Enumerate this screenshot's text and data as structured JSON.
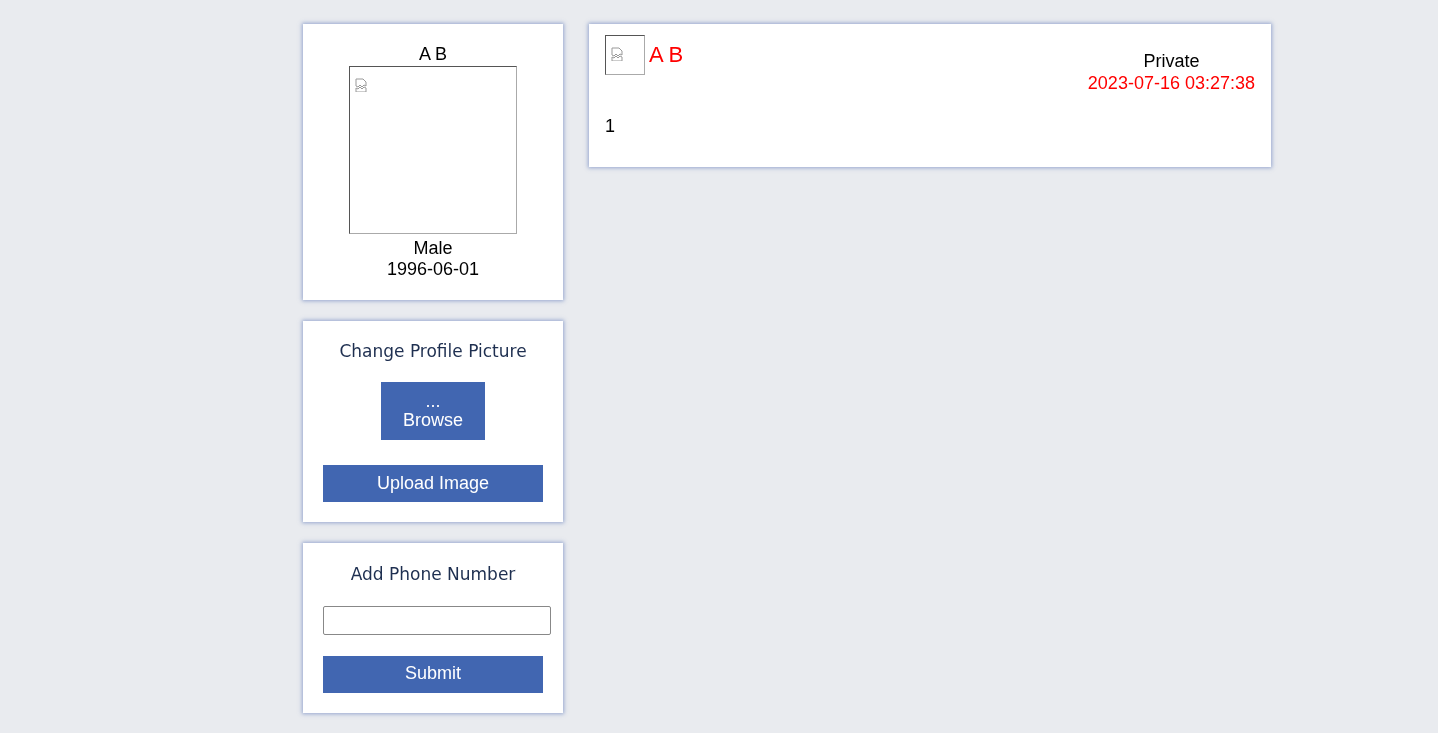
{
  "profile": {
    "name": "A B",
    "gender": "Male",
    "birthdate": "1996-06-01"
  },
  "change_picture": {
    "title": "Change Profile Picture",
    "browse_button": {
      "dots": "...",
      "label": "Browse"
    },
    "upload_button": "Upload Image"
  },
  "phone": {
    "title": "Add Phone Number",
    "submit_button": "Submit"
  },
  "post": {
    "author": "A B",
    "visibility": "Private",
    "timestamp": "2023-07-16 03:27:38",
    "body": "1"
  }
}
